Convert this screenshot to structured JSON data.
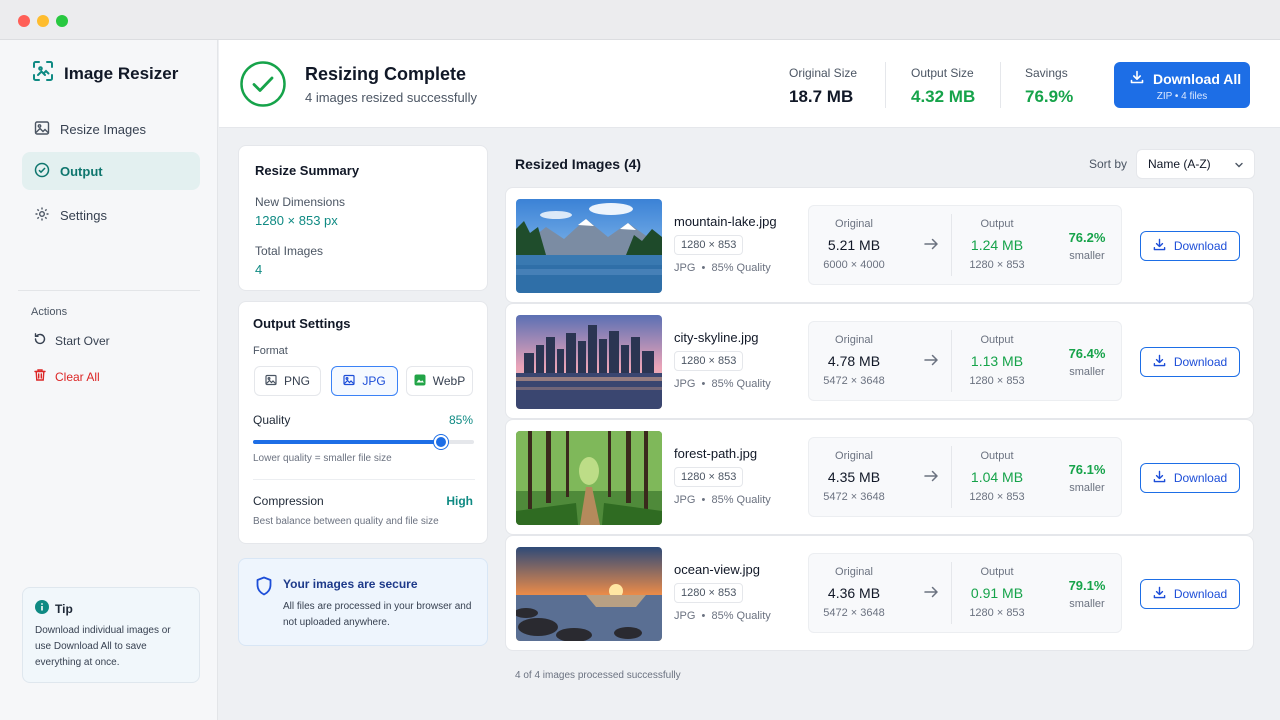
{
  "app": {
    "name": "Image Resizer"
  },
  "sidebar": {
    "items": [
      {
        "label": "Resize Images",
        "icon": "image-icon",
        "active": false
      },
      {
        "label": "Output",
        "icon": "check-circle-icon",
        "active": true
      },
      {
        "label": "Settings",
        "icon": "gear-icon",
        "active": false
      }
    ],
    "actions_label": "Actions",
    "actions": [
      {
        "label": "Start Over",
        "icon": "refresh-icon"
      },
      {
        "label": "Clear All",
        "icon": "trash-icon"
      }
    ],
    "tip": {
      "title": "Tip",
      "text": "Download individual images or use Download All to save everything at once."
    }
  },
  "header": {
    "title": "Resizing Complete",
    "subtitle": "4 images resized successfully",
    "stats": [
      {
        "label": "Original Size",
        "value": "18.7 MB"
      },
      {
        "label": "Output Size",
        "value": "4.32 MB"
      },
      {
        "label": "Savings",
        "value": "76.9%"
      }
    ],
    "download_all": {
      "label": "Download All",
      "sub": "ZIP • 4 files"
    }
  },
  "summary": {
    "title": "Resize Summary",
    "dimensions_label": "New Dimensions",
    "dimensions_value": "1280 × 853 px",
    "total_label": "Total Images",
    "total_value": "4"
  },
  "output_settings": {
    "title": "Output Settings",
    "format_label": "Format",
    "formats": [
      {
        "label": "PNG",
        "selected": false
      },
      {
        "label": "JPG",
        "selected": true
      },
      {
        "label": "WebP",
        "selected": false
      }
    ],
    "quality_label": "Quality",
    "quality_value": "85%",
    "quality_fraction": 0.85,
    "quality_hint": "Lower quality = smaller file size",
    "compression_label": "Compression",
    "compression_value": "High",
    "compression_hint": "Best balance between quality and file size"
  },
  "secure": {
    "title": "Your images are secure",
    "text": "All files are processed in your browser and not uploaded anywhere."
  },
  "list": {
    "title": "Resized Images (4)",
    "sort_label": "Sort by",
    "sort_value": "Name (A-Z)",
    "original_label": "Original",
    "output_label": "Output",
    "smaller_label": "smaller",
    "download_label": "Download",
    "images": [
      {
        "name": "mountain-lake.jpg",
        "dims": "1280 × 853",
        "format": "JPG",
        "quality": "85% Quality",
        "orig_size": "5.21 MB",
        "orig_px": "6000 × 4000",
        "out_size": "1.24 MB",
        "out_px": "1280 × 853",
        "pct": "76.2%"
      },
      {
        "name": "city-skyline.jpg",
        "dims": "1280 × 853",
        "format": "JPG",
        "quality": "85% Quality",
        "orig_size": "4.78 MB",
        "orig_px": "5472 × 3648",
        "out_size": "1.13 MB",
        "out_px": "1280 × 853",
        "pct": "76.4%"
      },
      {
        "name": "forest-path.jpg",
        "dims": "1280 × 853",
        "format": "JPG",
        "quality": "85% Quality",
        "orig_size": "4.35 MB",
        "orig_px": "5472 × 3648",
        "out_size": "1.04 MB",
        "out_px": "1280 × 853",
        "pct": "76.1%"
      },
      {
        "name": "ocean-view.jpg",
        "dims": "1280 × 853",
        "format": "JPG",
        "quality": "85% Quality",
        "orig_size": "4.36 MB",
        "orig_px": "5472 × 3648",
        "out_size": "0.91 MB",
        "out_px": "1280 × 853",
        "pct": "79.1%"
      }
    ],
    "footer": "4 of 4 images processed successfully"
  },
  "colors": {
    "accent": "#1d6ee6",
    "teal": "#0f8a83",
    "success": "#16a34a",
    "danger": "#dc2626"
  }
}
